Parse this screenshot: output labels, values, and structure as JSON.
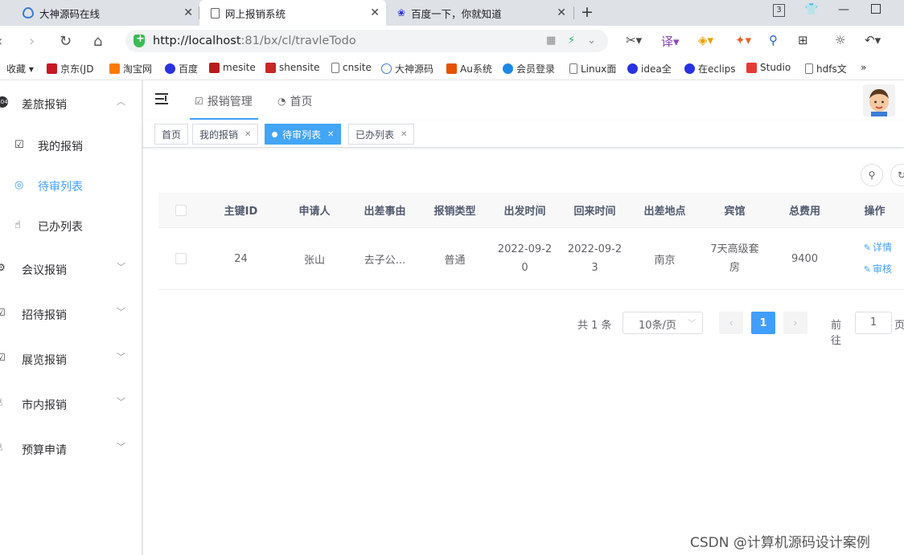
{
  "browser": {
    "tabs": [
      {
        "title": "大神源码在线"
      },
      {
        "title": "网上报销系统"
      },
      {
        "title": "百度一下，你就知道"
      }
    ],
    "tab_count_badge": "3",
    "url_host": "http://localhost",
    "url_rest": ":81/bx/cl/travleTodo",
    "bookmarks": [
      "收藏",
      "京东(JD",
      "淘宝网",
      "百度",
      "mesite",
      "shensite",
      "cnsite",
      "大神源码",
      "Au系统",
      "会员登录",
      "Linux面",
      "idea全",
      "在eclips",
      "Studio",
      "hdfs文"
    ],
    "bookmarks_more": "»"
  },
  "sidebar": {
    "groups": [
      {
        "label": "差旅报销",
        "expanded": true,
        "items": [
          {
            "label": "我的报销",
            "icon": "checkbox-icon"
          },
          {
            "label": "待审列表",
            "icon": "radar-icon",
            "active": true
          },
          {
            "label": "已办列表",
            "icon": "hand-icon"
          }
        ]
      },
      {
        "label": "会议报销"
      },
      {
        "label": "招待报销"
      },
      {
        "label": "展览报销"
      },
      {
        "label": "市内报销"
      },
      {
        "label": "预算申请"
      }
    ]
  },
  "topnav": {
    "tabs": [
      {
        "label": "报销管理",
        "active": true
      },
      {
        "label": "首页"
      }
    ]
  },
  "tags": [
    {
      "label": "首页",
      "closable": false
    },
    {
      "label": "我的报销",
      "closable": true
    },
    {
      "label": "待审列表",
      "closable": true,
      "active": true
    },
    {
      "label": "已办列表",
      "closable": true
    }
  ],
  "table": {
    "columns": [
      "主键ID",
      "申请人",
      "出差事由",
      "报销类型",
      "出发时间",
      "回来时间",
      "出差地点",
      "宾馆",
      "总费用",
      "操作"
    ],
    "rows": [
      {
        "id": "24",
        "applicant": "张山",
        "reason": "去子公...",
        "type": "普通",
        "depart_l1": "2022-09-2",
        "depart_l2": "0",
        "return_l1": "2022-09-2",
        "return_l2": "3",
        "place": "南京",
        "hotel_l1": "7天高级套",
        "hotel_l2": "房",
        "total": "9400",
        "actions": [
          "详情",
          "审核"
        ]
      }
    ]
  },
  "pagination": {
    "total_text": "共 1 条",
    "page_size": "10条/页",
    "current_page": "1",
    "goto_label": "前往",
    "goto_value": "1",
    "page_suffix": "页"
  },
  "watermark": "CSDN @计算机源码设计案例",
  "colors": {
    "accent": "#409eff",
    "active_tag": "#42a5f5"
  }
}
